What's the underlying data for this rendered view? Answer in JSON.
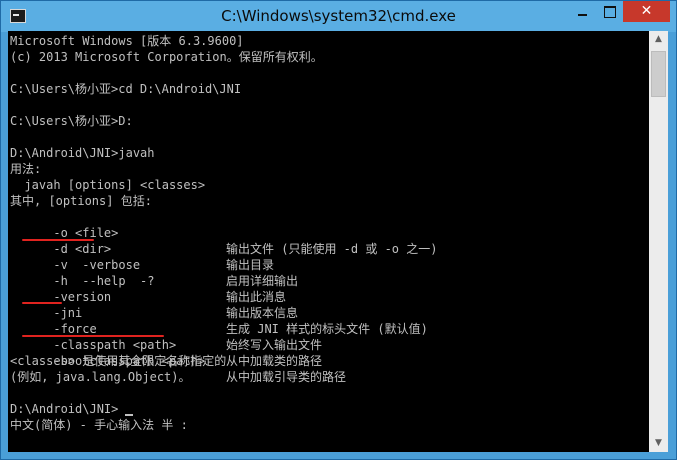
{
  "window": {
    "title": "C:\\Windows\\system32\\cmd.exe",
    "minimize_glyph": "",
    "maximize_glyph": "",
    "close_glyph": "✕",
    "icon": "console-icon",
    "scroll_up_glyph": "▲",
    "scroll_down_glyph": "▼"
  },
  "console": {
    "lines": [
      "Microsoft Windows [版本 6.3.9600]",
      "(c) 2013 Microsoft Corporation。保留所有权利。",
      "",
      "C:\\Users\\杨小亚>cd D:\\Android\\JNI",
      "",
      "C:\\Users\\杨小亚>D:",
      "",
      "D:\\Android\\JNI>javah",
      "用法:",
      "  javah [options] <classes>",
      "其中, [options] 包括:"
    ],
    "options": [
      {
        "flag": "  -o <file>",
        "desc": "输出文件 (只能使用 -d 或 -o 之一)"
      },
      {
        "flag": "  -d <dir>",
        "desc": "输出目录"
      },
      {
        "flag": "  -v  -verbose",
        "desc": "启用详细输出"
      },
      {
        "flag": "  -h  --help  -?",
        "desc": "输出此消息"
      },
      {
        "flag": "  -version",
        "desc": "输出版本信息"
      },
      {
        "flag": "  -jni",
        "desc": "生成 JNI 样式的标头文件 (默认值)"
      },
      {
        "flag": "  -force",
        "desc": "始终写入输出文件"
      },
      {
        "flag": "  -classpath <path>",
        "desc": "从中加载类的路径"
      },
      {
        "flag": "  -bootclasspath <path>",
        "desc": "从中加载引导类的路径"
      }
    ],
    "tail": [
      "<classes> 是使用其全限定名称指定的",
      "(例如, java.lang.Object)。",
      "",
      "D:\\Android\\JNI>",
      "中文(简体) - 手心输入法 半 :"
    ]
  },
  "annotation_color": "#e0231f"
}
